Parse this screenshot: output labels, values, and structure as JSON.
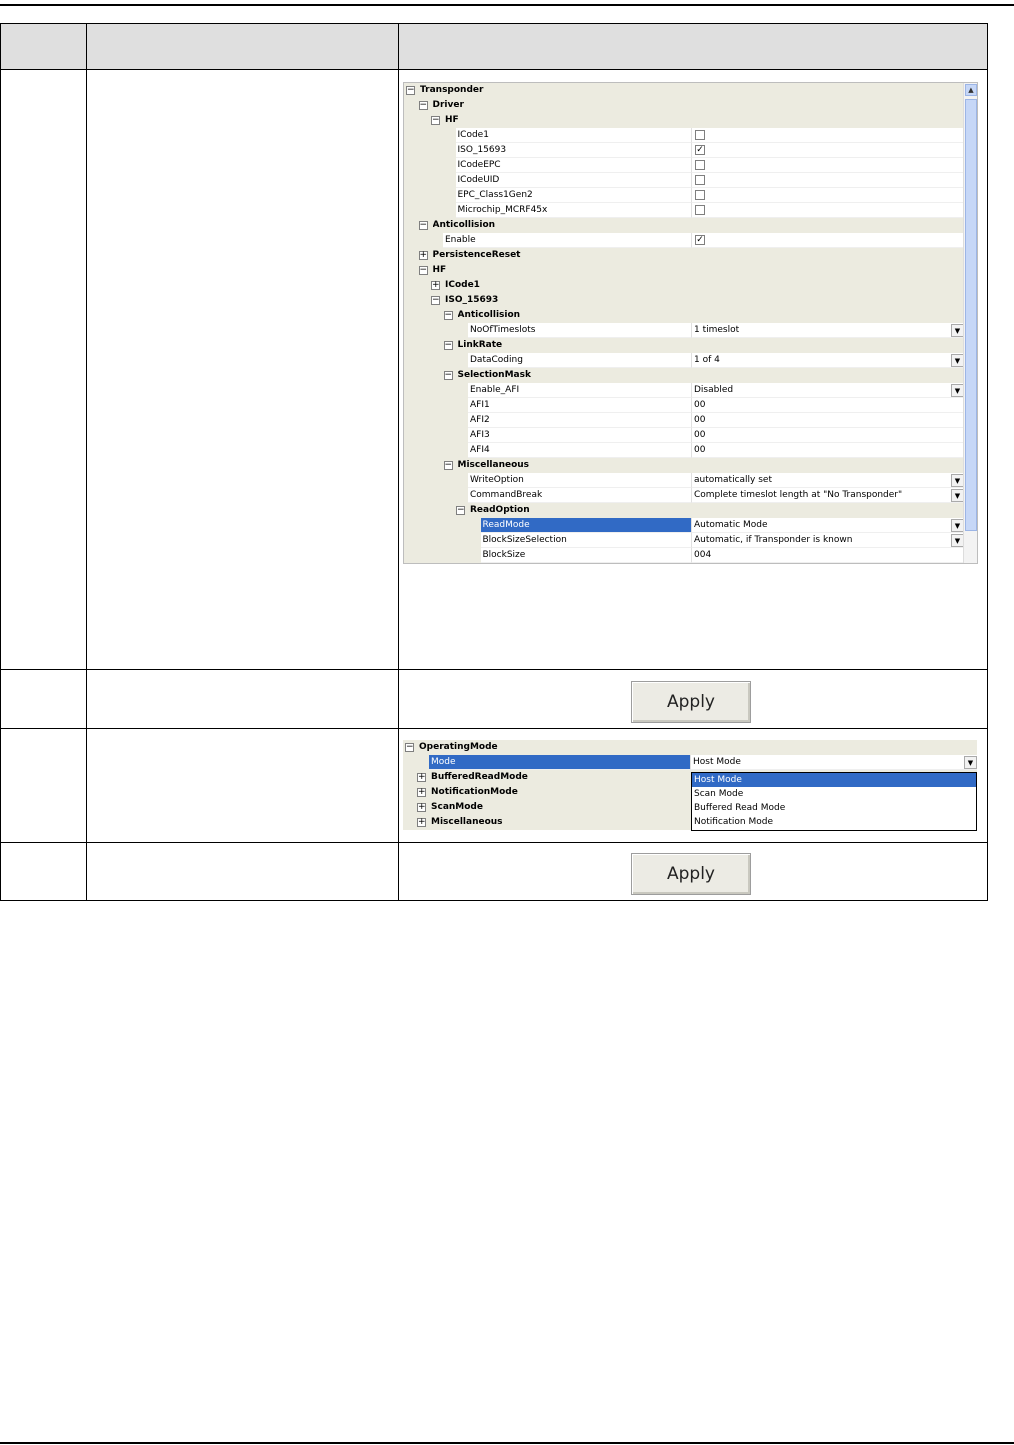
{
  "grid1": {
    "rows": [
      {
        "kind": "cat",
        "label": "Transponder",
        "indent": 0,
        "toggle": "minus"
      },
      {
        "kind": "cat",
        "label": "Driver",
        "indent": 1,
        "toggle": "minus"
      },
      {
        "kind": "cat",
        "label": "HF",
        "indent": 2,
        "toggle": "minus"
      },
      {
        "kind": "prop",
        "label": "ICode1",
        "indent": 3,
        "type": "checkbox",
        "checked": false
      },
      {
        "kind": "prop",
        "label": "ISO_15693",
        "indent": 3,
        "type": "checkbox",
        "checked": true
      },
      {
        "kind": "prop",
        "label": "ICodeEPC",
        "indent": 3,
        "type": "checkbox",
        "checked": false
      },
      {
        "kind": "prop",
        "label": "ICodeUID",
        "indent": 3,
        "type": "checkbox",
        "checked": false
      },
      {
        "kind": "prop",
        "label": "EPC_Class1Gen2",
        "indent": 3,
        "type": "checkbox",
        "checked": false
      },
      {
        "kind": "prop",
        "label": "Microchip_MCRF45x",
        "indent": 3,
        "type": "checkbox",
        "checked": false
      },
      {
        "kind": "cat",
        "label": "Anticollision",
        "indent": 1,
        "toggle": "minus"
      },
      {
        "kind": "prop",
        "label": "Enable",
        "indent": 2,
        "type": "checkbox",
        "checked": true
      },
      {
        "kind": "cat",
        "label": "PersistenceReset",
        "indent": 1,
        "toggle": "plus"
      },
      {
        "kind": "cat",
        "label": "HF",
        "indent": 1,
        "toggle": "minus"
      },
      {
        "kind": "cat",
        "label": "ICode1",
        "indent": 2,
        "toggle": "plus"
      },
      {
        "kind": "cat",
        "label": "ISO_15693",
        "indent": 2,
        "toggle": "minus"
      },
      {
        "kind": "cat",
        "label": "Anticollision",
        "indent": 3,
        "toggle": "minus"
      },
      {
        "kind": "prop",
        "label": "NoOfTimeslots",
        "indent": 4,
        "type": "dropdown",
        "value": "1 timeslot"
      },
      {
        "kind": "cat",
        "label": "LinkRate",
        "indent": 3,
        "toggle": "minus"
      },
      {
        "kind": "prop",
        "label": "DataCoding",
        "indent": 4,
        "type": "dropdown",
        "value": "1 of 4"
      },
      {
        "kind": "cat",
        "label": "SelectionMask",
        "indent": 3,
        "toggle": "minus"
      },
      {
        "kind": "prop",
        "label": "Enable_AFI",
        "indent": 4,
        "type": "dropdown",
        "value": "Disabled"
      },
      {
        "kind": "prop",
        "label": "AFI1",
        "indent": 4,
        "type": "text",
        "value": "00"
      },
      {
        "kind": "prop",
        "label": "AFI2",
        "indent": 4,
        "type": "text",
        "value": "00"
      },
      {
        "kind": "prop",
        "label": "AFI3",
        "indent": 4,
        "type": "text",
        "value": "00"
      },
      {
        "kind": "prop",
        "label": "AFI4",
        "indent": 4,
        "type": "text",
        "value": "00"
      },
      {
        "kind": "cat",
        "label": "Miscellaneous",
        "indent": 3,
        "toggle": "minus"
      },
      {
        "kind": "prop",
        "label": "WriteOption",
        "indent": 4,
        "type": "dropdown",
        "value": "automatically set"
      },
      {
        "kind": "prop",
        "label": "CommandBreak",
        "indent": 4,
        "type": "dropdown",
        "value": "Complete timeslot length at \"No Transponder\""
      },
      {
        "kind": "cat",
        "label": "ReadOption",
        "indent": 4,
        "toggle": "minus"
      },
      {
        "kind": "prop",
        "label": "ReadMode",
        "indent": 5,
        "type": "dropdown",
        "value": "Automatic Mode",
        "selected": true
      },
      {
        "kind": "prop",
        "label": "BlockSizeSelection",
        "indent": 5,
        "type": "dropdown",
        "value": "Automatic, if Transponder is known"
      },
      {
        "kind": "prop",
        "label": "BlockSize",
        "indent": 5,
        "type": "text",
        "value": "004"
      }
    ]
  },
  "apply_label": "Apply",
  "grid2": {
    "rows": [
      {
        "kind": "cat",
        "label": "OperatingMode",
        "indent": 0,
        "toggle": "minus"
      },
      {
        "kind": "prop",
        "label": "Mode",
        "indent": 1,
        "type": "dropdown",
        "value": "Host Mode",
        "selected": true
      },
      {
        "kind": "cat",
        "label": "BufferedReadMode",
        "indent": 1,
        "toggle": "plus"
      },
      {
        "kind": "cat",
        "label": "NotificationMode",
        "indent": 1,
        "toggle": "plus"
      },
      {
        "kind": "cat",
        "label": "ScanMode",
        "indent": 1,
        "toggle": "plus"
      },
      {
        "kind": "cat",
        "label": "Miscellaneous",
        "indent": 1,
        "toggle": "plus"
      }
    ],
    "mode_options": [
      "Host Mode",
      "Scan Mode",
      "Buffered Read Mode",
      "Notification Mode"
    ],
    "mode_selected": "Host Mode"
  },
  "icons": {
    "expanded": "minus-box-icon",
    "collapsed": "plus-box-icon",
    "dropdown": "chevron-down-icon",
    "check": "checkmark-icon"
  }
}
